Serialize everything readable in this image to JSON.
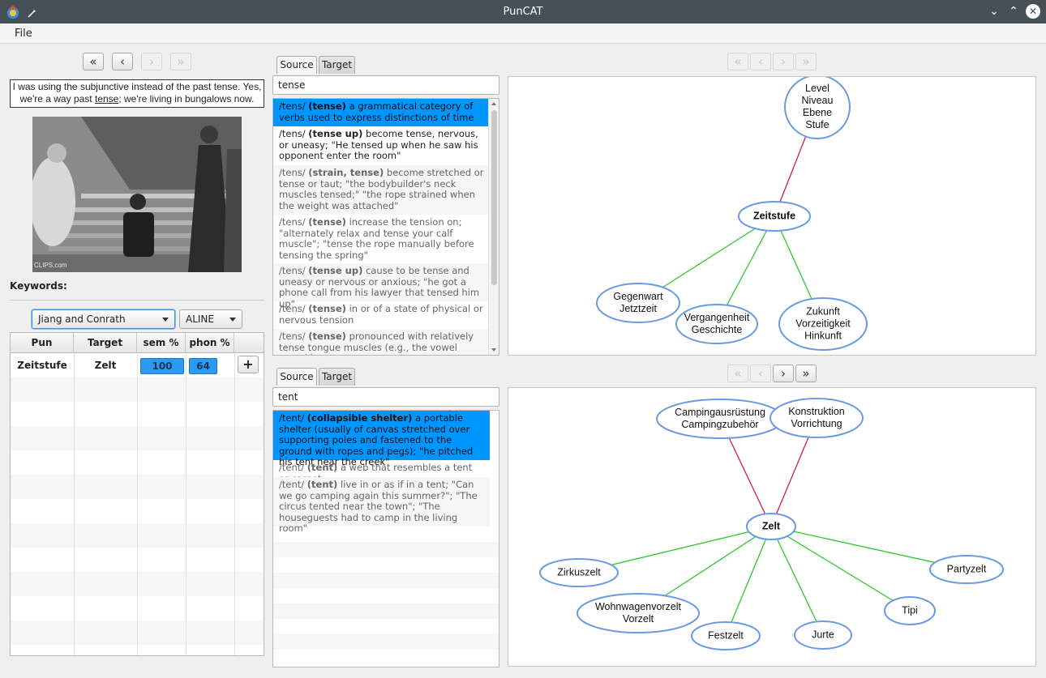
{
  "window": {
    "title": "PunCAT"
  },
  "menu": {
    "file": "File"
  },
  "caption": {
    "before": "I was using the subjunctive instead of the past tense. Yes, we're a way past ",
    "underlined": "tense",
    "after": "; we're living in bungalows now."
  },
  "video": {
    "watermark": "CLIPS.com"
  },
  "keywords": {
    "label": "Keywords:"
  },
  "selectors": {
    "semantic": "Jiang and Conrath",
    "phonetic": "ALINE"
  },
  "table": {
    "headers": [
      "Pun",
      "Target",
      "sem %",
      "phon %"
    ],
    "rows": [
      {
        "pun": "Zeitstufe",
        "target": "Zelt",
        "sem": 100,
        "phon": 64
      }
    ],
    "add_button": "+"
  },
  "tabs": {
    "source": "Source",
    "target": "Target"
  },
  "source_panel": {
    "search": "tense",
    "entries": [
      {
        "pron": "/tens/ ",
        "head": "(tense)",
        "gloss": " a grammatical category of verbs used to express distinctions of time"
      },
      {
        "pron": "/tens/ ",
        "head": "(tense up)",
        "gloss": " become tense, nervous, or uneasy; \"He tensed up when he saw his opponent enter the room\""
      },
      {
        "pron": "/tens/ ",
        "head": "(strain, tense)",
        "gloss": " become stretched or tense or taut; \"the bodybuilder's neck muscles tensed;\" \"the rope strained when the weight was attached\""
      },
      {
        "pron": "/tens/ ",
        "head": "(tense)",
        "gloss": " increase the tension on; \"alternately relax and tense your calf muscle\"; \"tense the rope manually before tensing the spring\""
      },
      {
        "pron": "/tens/ ",
        "head": "(tense up)",
        "gloss": " cause to be tense and uneasy or nervous or anxious; \"he got a phone call from his lawyer that tensed him up\""
      },
      {
        "pron": "/tens/ ",
        "head": "(tense)",
        "gloss": " in or of a state of physical or nervous tension"
      },
      {
        "pron": "/tens/ ",
        "head": "(tense)",
        "gloss": " pronounced with relatively tense tongue muscles (e.g., the vowel sound in"
      }
    ]
  },
  "target_panel": {
    "search": "tent",
    "entries": [
      {
        "pron": "/tent/ ",
        "head": "(collapsible shelter)",
        "gloss": " a portable shelter (usually of canvas stretched over supporting poles and fastened to the ground with ropes and pegs); \"he pitched his tent near the creek\""
      },
      {
        "pron": "/tent/ ",
        "head": "(tent)",
        "gloss": " a web that resembles a tent or carpet"
      },
      {
        "pron": "/tent/ ",
        "head": "(tent)",
        "gloss": " live in or as if in a tent; \"Can we go camping again this summer?\"; \"The circus tented near the town\"; \"The houseguests had to camp in the living room\""
      }
    ]
  },
  "source_graph": {
    "center": [
      "Zeitstufe"
    ],
    "hypernyms": [
      [
        "Level",
        "Niveau",
        "Ebene",
        "Stufe"
      ]
    ],
    "hyponyms": [
      [
        "Gegenwart",
        "Jetztzeit"
      ],
      [
        "Vergangenheit",
        "Geschichte"
      ],
      [
        "Zukunft",
        "Vorzeitigkeit",
        "Hinkunft"
      ]
    ]
  },
  "target_graph": {
    "center": [
      "Zelt"
    ],
    "hypernyms": [
      [
        "Campingausrüstung",
        "Campingzubehör"
      ],
      [
        "Konstruktion",
        "Vorrichtung"
      ]
    ],
    "hyponyms": [
      [
        "Zirkuszelt"
      ],
      [
        "Wohnwagenvorzelt",
        "Vorzelt"
      ],
      [
        "Festzelt"
      ],
      [
        "Jurte"
      ],
      [
        "Tipi"
      ],
      [
        "Partyzelt"
      ]
    ]
  },
  "colors": {
    "hypernym_edge": "#d0203c",
    "hyponym_edge": "#2ec82e",
    "node_stroke": "#6a9ae3",
    "selection": "#0096ff"
  }
}
